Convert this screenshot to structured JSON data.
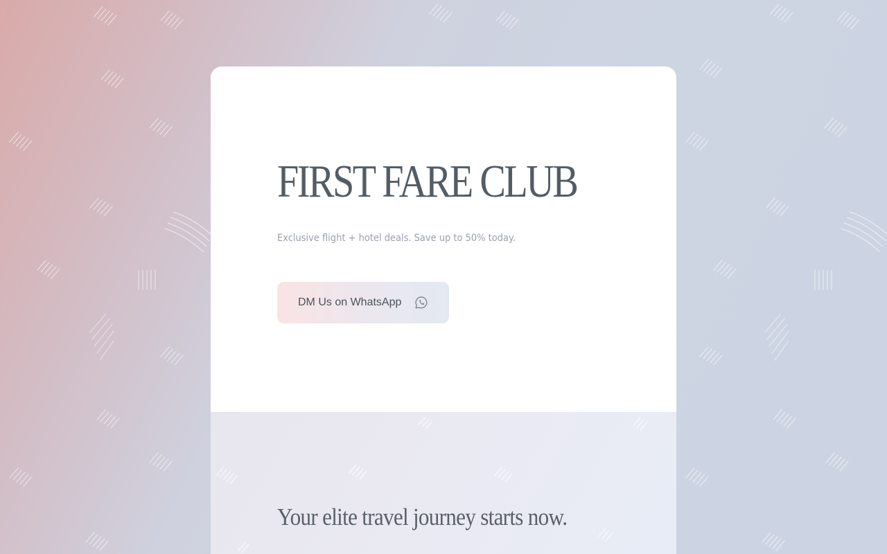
{
  "hero": {
    "title": "FIRST FARE CLUB",
    "tagline": "Exclusive flight + hotel deals. Save up to 50% today.",
    "cta_label": "DM Us on WhatsApp",
    "cta_icon": "whatsapp-icon"
  },
  "section": {
    "heading": "Your elite travel journey starts now."
  },
  "colors": {
    "title": "#545c64",
    "tagline": "#9aa0ab",
    "cta_start": "#fae3e4",
    "cta_end": "#e3e9f2",
    "bg_warm": "#d9aaa8",
    "bg_cool": "#ccd4e3"
  }
}
